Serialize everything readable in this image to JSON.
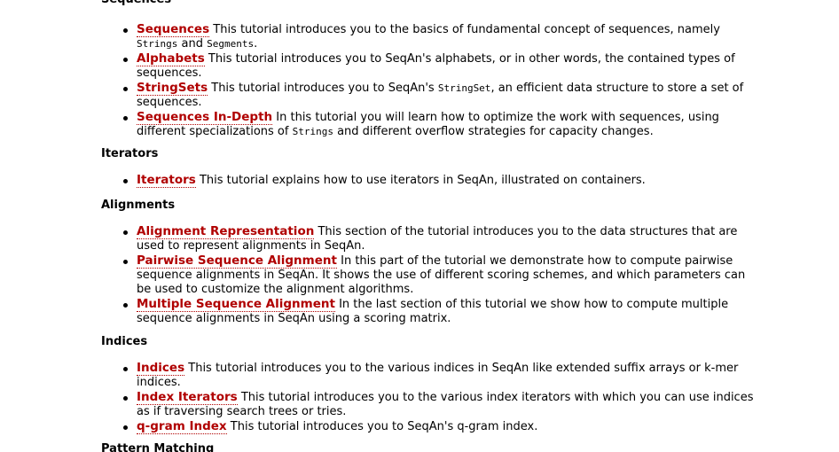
{
  "sections": [
    {
      "title": "Sequences",
      "items": [
        {
          "link": "Sequences",
          "parts": [
            "This tutorial introduces you to the basics of fundamental concept of sequences, namely ",
            "Strings",
            " and ",
            "Segments",
            "."
          ]
        },
        {
          "link": "Alphabets",
          "parts": [
            "This tutorial introduces you to SeqAn's alphabets, or in other words, the contained types of sequences."
          ]
        },
        {
          "link": "StringSets",
          "parts": [
            "This tutorial introduces you to SeqAn's ",
            "StringSet",
            ", an efficient data structure to store a set of sequences."
          ]
        },
        {
          "link": "Sequences In-Depth",
          "parts": [
            "In this tutorial you will learn how to optimize the work with sequences, using different specializations of ",
            "Strings",
            " and different overflow strategies for capacity changes."
          ]
        }
      ]
    },
    {
      "title": "Iterators",
      "items": [
        {
          "link": "Iterators",
          "parts": [
            "This tutorial explains how to use iterators in SeqAn, illustrated on containers."
          ]
        }
      ]
    },
    {
      "title": "Alignments",
      "items": [
        {
          "link": "Alignment Representation",
          "parts": [
            "This section of the tutorial introduces you to the data structures that are used to represent alignments in SeqAn."
          ]
        },
        {
          "link": "Pairwise Sequence Alignment",
          "parts": [
            "In this part of the tutorial we demonstrate how to compute pairwise sequence alignments in SeqAn. It shows the use of different scoring schemes, and which parameters can be used to customize the alignment algorithms."
          ]
        },
        {
          "link": "Multiple Sequence Alignment",
          "parts": [
            "In the last section of this tutorial we show how to compute multiple sequence alignments in SeqAn using a scoring matrix."
          ]
        }
      ]
    },
    {
      "title": "Indices",
      "items": [
        {
          "link": "Indices",
          "parts": [
            "This tutorial introduces you to the various indices in SeqAn like extended suffix arrays or k-mer indices."
          ]
        },
        {
          "link": "Index Iterators",
          "parts": [
            "This tutorial introduces you to the various index iterators with which you can use indices as if traversing search trees or tries."
          ]
        },
        {
          "link": "q-gram Index",
          "parts": [
            "This tutorial introduces you to SeqAn's q-gram index."
          ]
        }
      ]
    },
    {
      "title": "Pattern Matching",
      "items": []
    }
  ],
  "colors": {
    "link": "#b00000",
    "text": "#000000",
    "background": "#ffffff"
  }
}
